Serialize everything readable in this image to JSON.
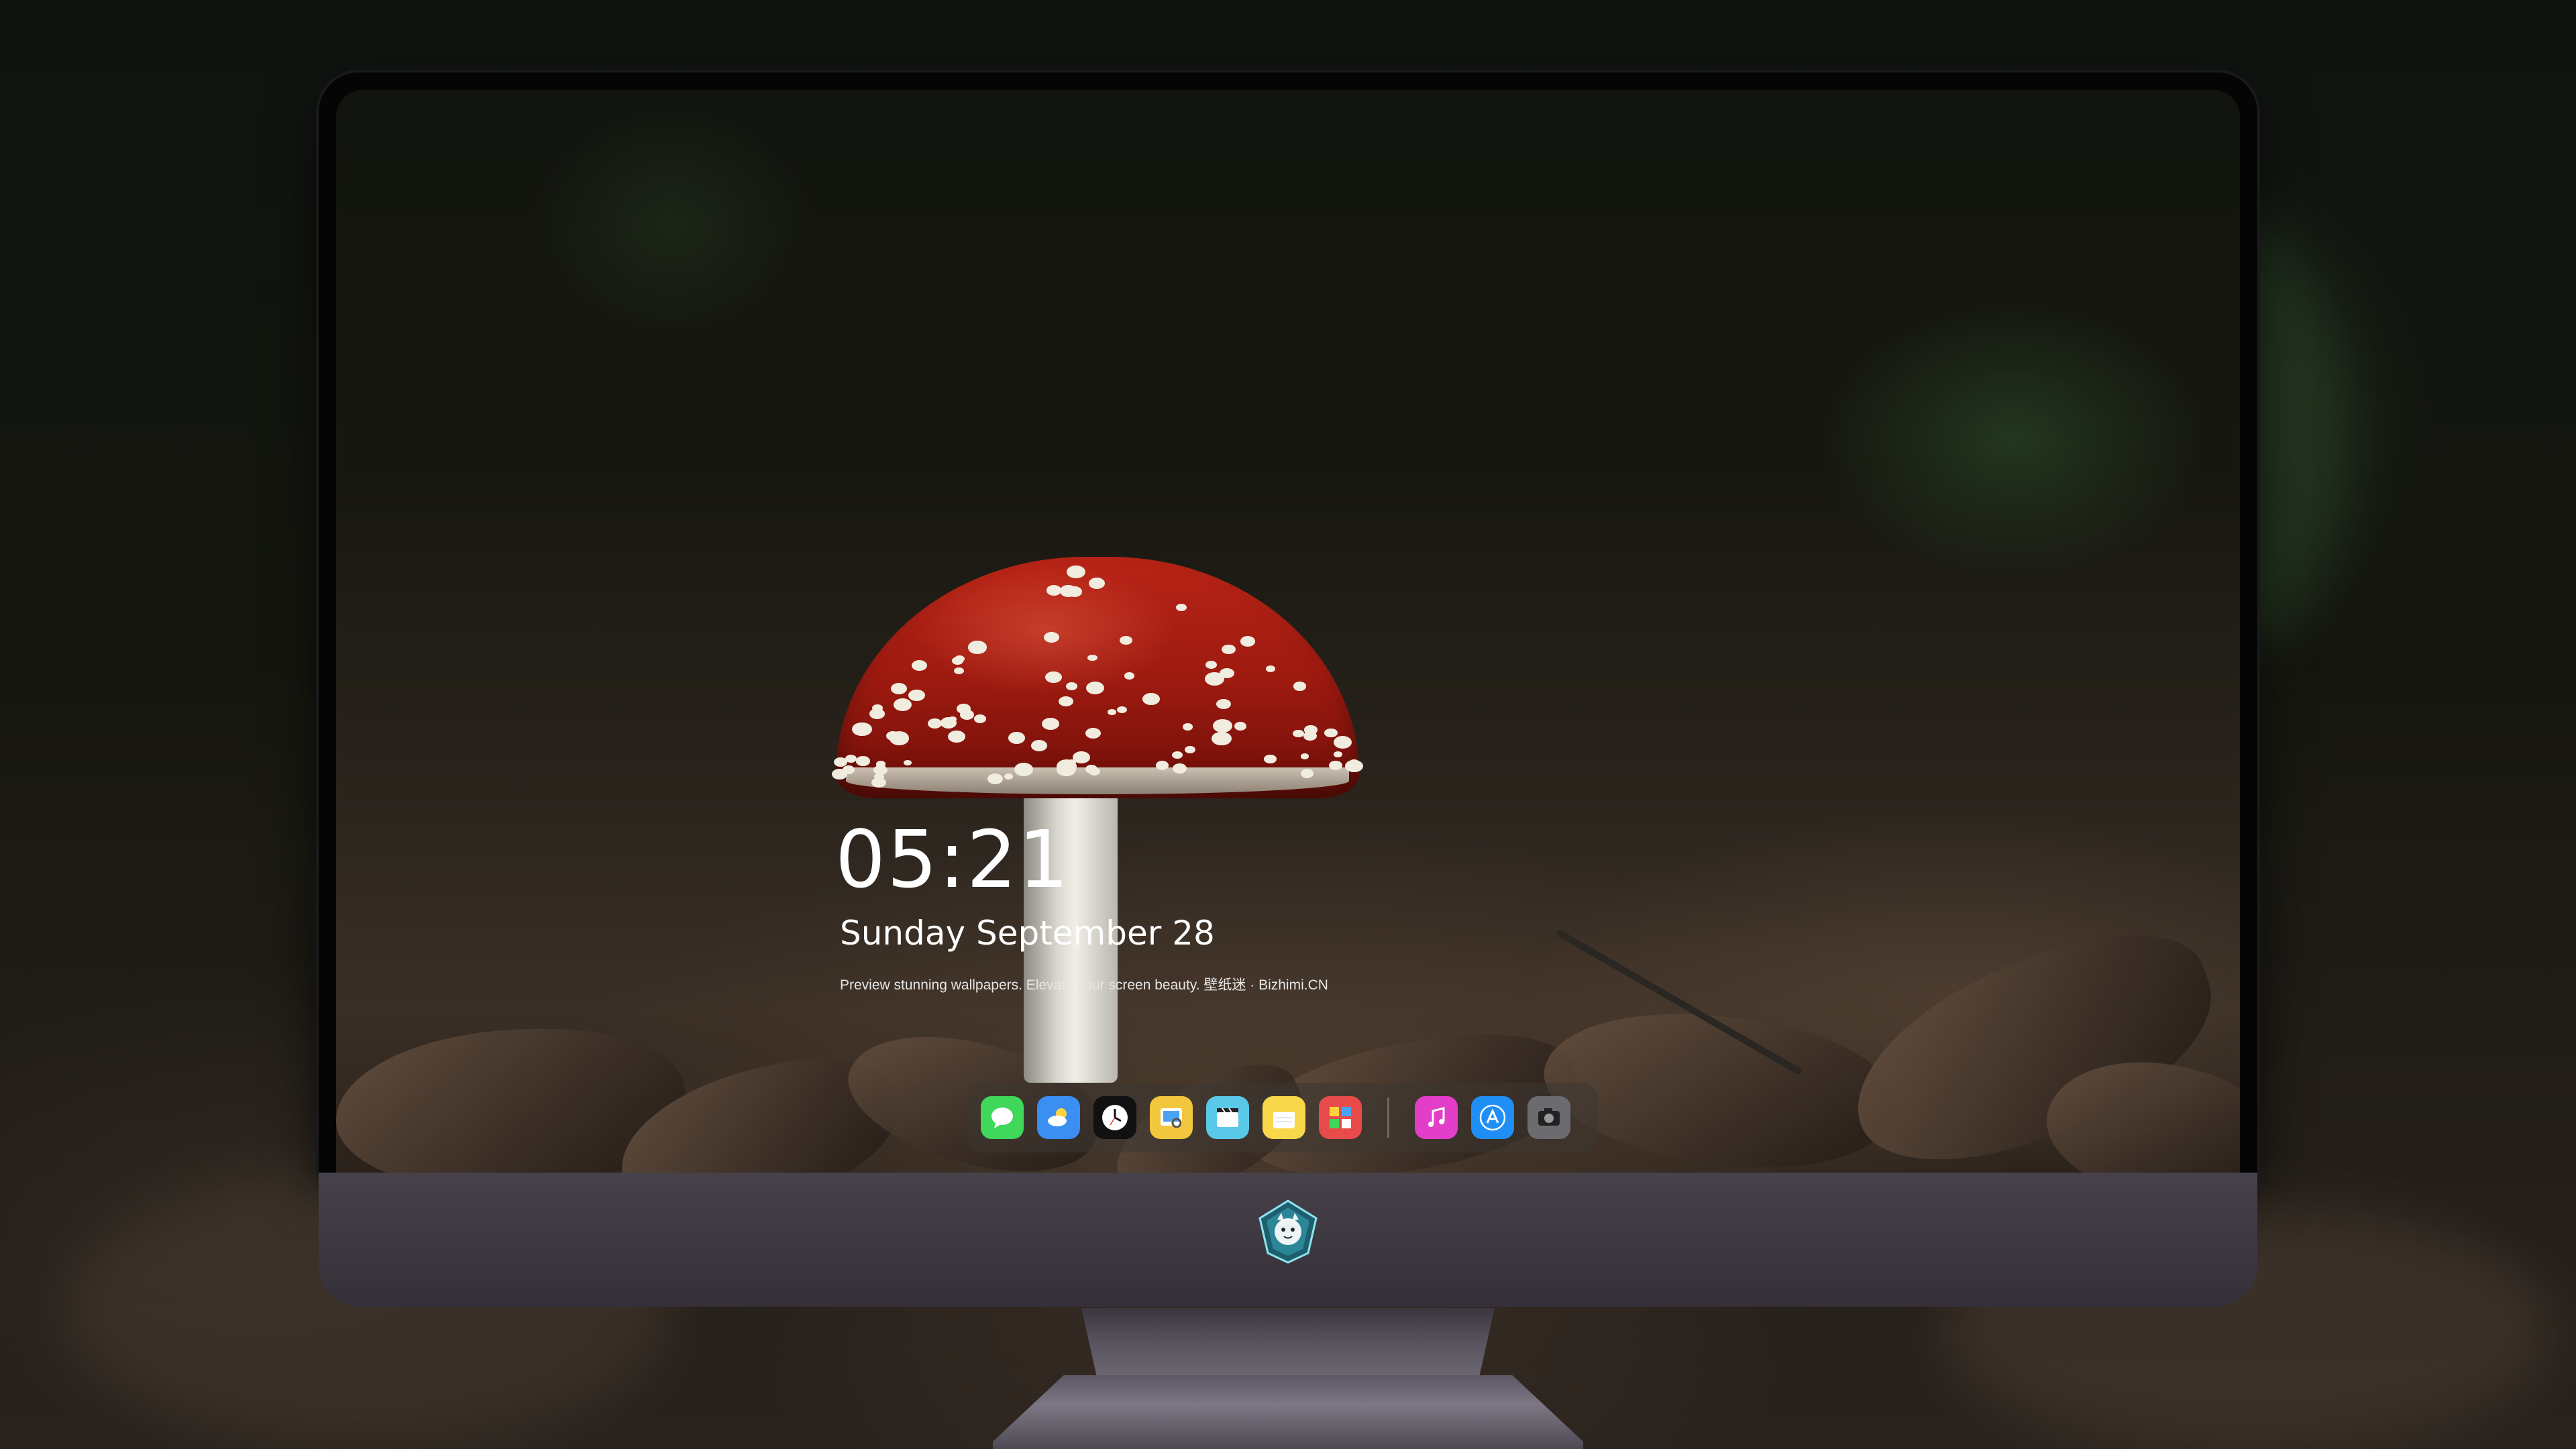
{
  "lock_screen": {
    "time": "05:21",
    "date": "Sunday September  28",
    "tagline": "Preview stunning wallpapers. Elevate your screen beauty. 壁纸迷 · Bizhimi.CN"
  },
  "dock": {
    "apps": [
      {
        "name": "messages-icon",
        "color": "#3fd85a"
      },
      {
        "name": "weather-icon",
        "color": "#3b8ef2"
      },
      {
        "name": "clock-icon",
        "color": "#111111"
      },
      {
        "name": "preview-icon",
        "color": "#f3c73d"
      },
      {
        "name": "clips-icon",
        "color": "#5ac8e8"
      },
      {
        "name": "notes-icon",
        "color": "#f8d84a"
      },
      {
        "name": "photo-booth-icon",
        "color": "#e94b4b"
      },
      {
        "name": "itunes-icon",
        "color": "#e33ec9"
      },
      {
        "name": "app-store-icon",
        "color": "#1f8ef5"
      },
      {
        "name": "camera-icon",
        "color": "#6b6b70"
      }
    ]
  },
  "colors": {
    "mushroom_cap": "#b82416",
    "monitor_chin": "#47424a",
    "bezel": "#050505"
  }
}
